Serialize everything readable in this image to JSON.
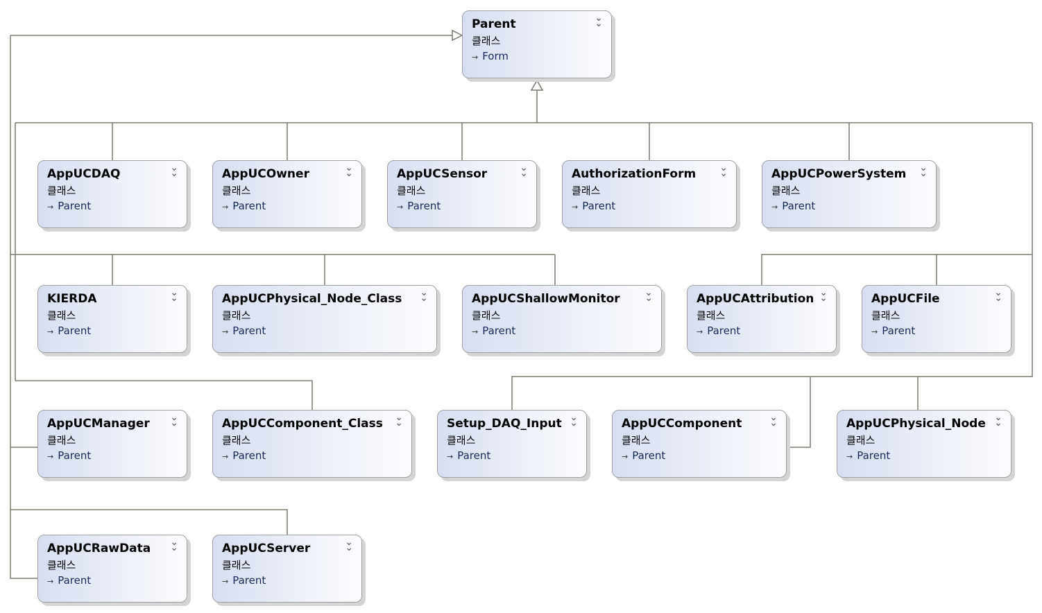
{
  "diagram": {
    "kind_label": "클래스",
    "root": {
      "name": "Parent",
      "base": "Form"
    },
    "classes": [
      {
        "name": "AppUCDAQ",
        "base": "Parent"
      },
      {
        "name": "AppUCOwner",
        "base": "Parent"
      },
      {
        "name": "AppUCSensor",
        "base": "Parent"
      },
      {
        "name": "AuthorizationForm",
        "base": "Parent"
      },
      {
        "name": "AppUCPowerSystem",
        "base": "Parent"
      },
      {
        "name": "KIERDA",
        "base": "Parent"
      },
      {
        "name": "AppUCPhysical_Node_Class",
        "base": "Parent"
      },
      {
        "name": "AppUCShallowMonitor",
        "base": "Parent"
      },
      {
        "name": "AppUCAttribution",
        "base": "Parent"
      },
      {
        "name": "AppUCFile",
        "base": "Parent"
      },
      {
        "name": "AppUCManager",
        "base": "Parent"
      },
      {
        "name": "AppUCComponent_Class",
        "base": "Parent"
      },
      {
        "name": "Setup_DAQ_Input",
        "base": "Parent"
      },
      {
        "name": "AppUCComponent",
        "base": "Parent"
      },
      {
        "name": "AppUCPhysical_Node",
        "base": "Parent"
      },
      {
        "name": "AppUCRawData",
        "base": "Parent"
      },
      {
        "name": "AppUCServer",
        "base": "Parent"
      }
    ],
    "colors": {
      "line": "#7a7a70",
      "box_start": "#d6deef",
      "box_end": "#fbfcfe"
    },
    "icons": {
      "collapse": "double-chevron-down-icon",
      "inherit": "inheritance-arrow-icon"
    }
  }
}
